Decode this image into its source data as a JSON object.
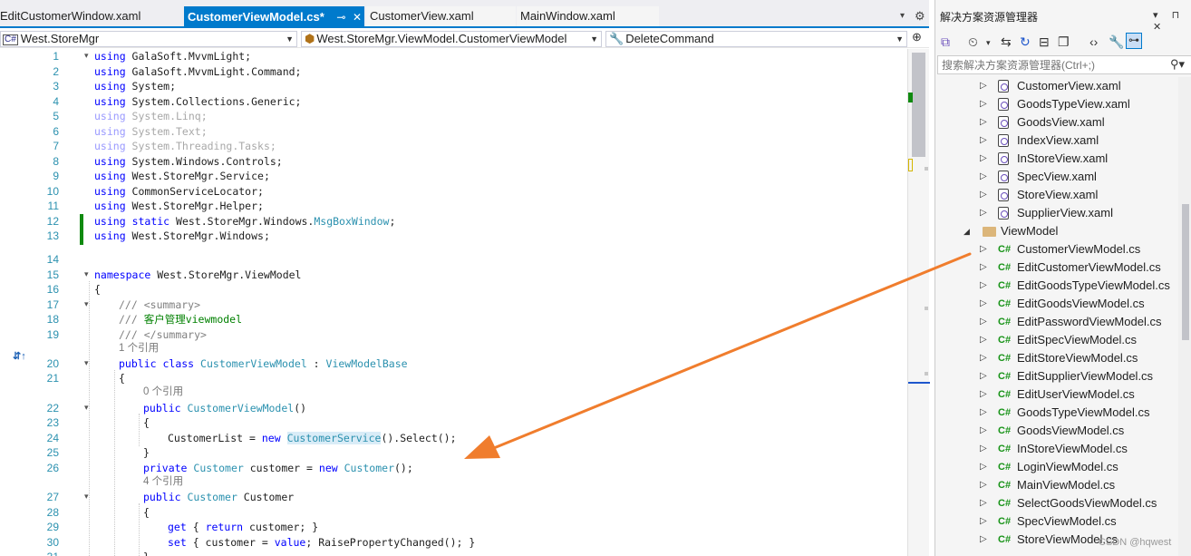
{
  "tabs": [
    {
      "label": "EditCustomerWindow.xaml",
      "active": false
    },
    {
      "label": "CustomerViewModel.cs*",
      "active": true
    },
    {
      "label": "CustomerView.xaml",
      "active": false
    },
    {
      "label": "MainWindow.xaml",
      "active": false
    }
  ],
  "tab_icons": {
    "pin": "⊸",
    "close": "✕",
    "overflow": "▾",
    "settings": "⚙"
  },
  "navbar": {
    "project": "West.StoreMgr",
    "project_icon": "C#",
    "class": "West.StoreMgr.ViewModel.CustomerViewModel",
    "member": "DeleteCommand"
  },
  "code_lines": [
    {
      "n": "1",
      "t": "using GalaSoft.MvvmLight;"
    },
    {
      "n": "2",
      "t": "using GalaSoft.MvvmLight.Command;"
    },
    {
      "n": "3",
      "t": "using System;"
    },
    {
      "n": "4",
      "t": "using System.Collections.Generic;"
    },
    {
      "n": "5",
      "t": "using System.Linq;"
    },
    {
      "n": "6",
      "t": "using System.Text;"
    },
    {
      "n": "7",
      "t": "using System.Threading.Tasks;"
    },
    {
      "n": "8",
      "t": "using System.Windows.Controls;"
    },
    {
      "n": "9",
      "t": "using West.StoreMgr.Service;"
    },
    {
      "n": "10",
      "t": "using CommonServiceLocator;"
    },
    {
      "n": "11",
      "t": "using West.StoreMgr.Helper;"
    },
    {
      "n": "12",
      "t": "using static West.StoreMgr.Windows.MsgBoxWindow;"
    },
    {
      "n": "13",
      "t": "using West.StoreMgr.Windows;"
    },
    {
      "n": "14",
      "t": ""
    },
    {
      "n": "15",
      "t": "namespace West.StoreMgr.ViewModel"
    },
    {
      "n": "16",
      "t": "{"
    },
    {
      "n": "17",
      "t": "/// <summary>"
    },
    {
      "n": "18",
      "t": "/// 客户管理viewmodel"
    },
    {
      "n": "19",
      "t": "/// </summary>"
    },
    {
      "n": "20",
      "t": "public class CustomerViewModel : ViewModelBase"
    },
    {
      "n": "21",
      "t": "{"
    },
    {
      "n": "22",
      "t": "public CustomerViewModel()"
    },
    {
      "n": "23",
      "t": "{"
    },
    {
      "n": "24",
      "t": "CustomerList = new CustomerService().Select();"
    },
    {
      "n": "25",
      "t": "}"
    },
    {
      "n": "26",
      "t": "private Customer customer = new Customer();"
    },
    {
      "n": "27",
      "t": "public Customer Customer"
    },
    {
      "n": "28",
      "t": "{"
    },
    {
      "n": "29",
      "t": "get { return customer; }"
    },
    {
      "n": "30",
      "t": "set { customer = value; RaisePropertyChanged(); }"
    },
    {
      "n": "31",
      "t": "}"
    }
  ],
  "code_hints": [
    "1 个引用",
    "0 个引用",
    "4 个引用"
  ],
  "explorer": {
    "title": "解决方案资源管理器",
    "title_controls": "▾ ⊓ ✕",
    "search_placeholder": "搜索解决方案资源管理器(Ctrl+;)",
    "items": [
      {
        "label": "CustomerView.xaml",
        "kind": "xaml"
      },
      {
        "label": "GoodsTypeView.xaml",
        "kind": "xaml"
      },
      {
        "label": "GoodsView.xaml",
        "kind": "xaml"
      },
      {
        "label": "IndexView.xaml",
        "kind": "xaml"
      },
      {
        "label": "InStoreView.xaml",
        "kind": "xaml"
      },
      {
        "label": "SpecView.xaml",
        "kind": "xaml"
      },
      {
        "label": "StoreView.xaml",
        "kind": "xaml"
      },
      {
        "label": "SupplierView.xaml",
        "kind": "xaml"
      },
      {
        "label": "ViewModel",
        "kind": "folder"
      },
      {
        "label": "CustomerViewModel.cs",
        "kind": "cs"
      },
      {
        "label": "EditCustomerViewModel.cs",
        "kind": "cs"
      },
      {
        "label": "EditGoodsTypeViewModel.cs",
        "kind": "cs"
      },
      {
        "label": "EditGoodsViewModel.cs",
        "kind": "cs"
      },
      {
        "label": "EditPasswordViewModel.cs",
        "kind": "cs"
      },
      {
        "label": "EditSpecViewModel.cs",
        "kind": "cs"
      },
      {
        "label": "EditStoreViewModel.cs",
        "kind": "cs"
      },
      {
        "label": "EditSupplierViewModel.cs",
        "kind": "cs"
      },
      {
        "label": "EditUserViewModel.cs",
        "kind": "cs"
      },
      {
        "label": "GoodsTypeViewModel.cs",
        "kind": "cs"
      },
      {
        "label": "GoodsViewModel.cs",
        "kind": "cs"
      },
      {
        "label": "InStoreViewModel.cs",
        "kind": "cs"
      },
      {
        "label": "LoginViewModel.cs",
        "kind": "cs"
      },
      {
        "label": "MainViewModel.cs",
        "kind": "cs"
      },
      {
        "label": "SelectGoodsViewModel.cs",
        "kind": "cs"
      },
      {
        "label": "SpecViewModel.cs",
        "kind": "cs"
      },
      {
        "label": "StoreViewModel.cs",
        "kind": "cs"
      }
    ]
  },
  "annotation": {
    "arrow_color": "#f07d2d"
  },
  "watermark": "CSDN @hqwest",
  "colors": {
    "accent": "#007acc",
    "keyword": "#0000ff",
    "type": "#2b91af",
    "comment": "#008000",
    "change_bar": "#108a10"
  }
}
